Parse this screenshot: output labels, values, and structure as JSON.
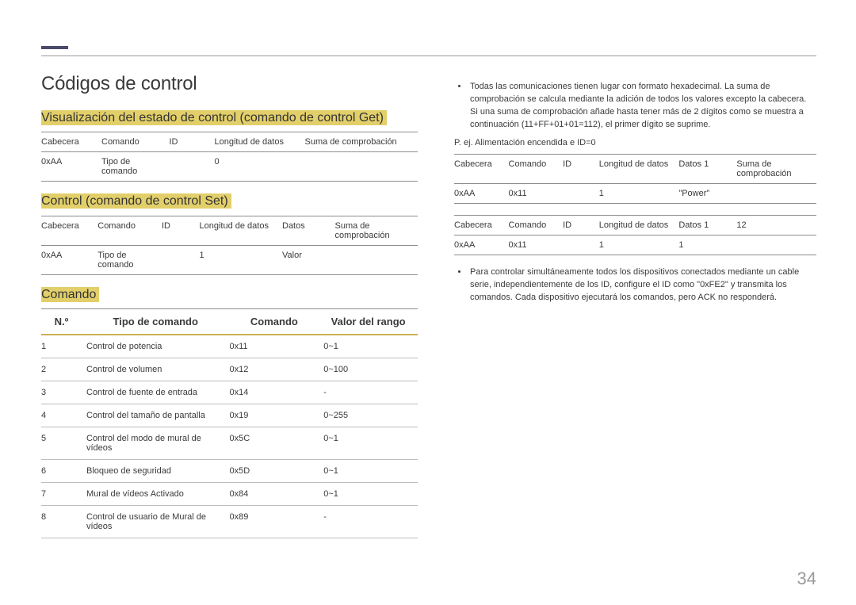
{
  "page_number": "34",
  "title": "Códigos de control",
  "section_get": {
    "heading": "Visualización del estado de control (comando de control Get)",
    "headers": [
      "Cabecera",
      "Comando",
      "ID",
      "Longitud de datos",
      "Suma de comprobación"
    ],
    "row": [
      "0xAA",
      "Tipo de comando",
      "",
      "0",
      ""
    ]
  },
  "section_set": {
    "heading": "Control (comando de control Set)",
    "headers": [
      "Cabecera",
      "Comando",
      "ID",
      "Longitud de datos",
      "Datos",
      "Suma de comprobación"
    ],
    "row": [
      "0xAA",
      "Tipo de comando",
      "",
      "1",
      "Valor",
      ""
    ]
  },
  "section_cmd": {
    "heading": "Comando",
    "headers": [
      "N.º",
      "Tipo de comando",
      "Comando",
      "Valor del rango"
    ],
    "rows": [
      [
        "1",
        "Control de potencia",
        "0x11",
        "0~1"
      ],
      [
        "2",
        "Control de volumen",
        "0x12",
        "0~100"
      ],
      [
        "3",
        "Control de fuente de entrada",
        "0x14",
        "-"
      ],
      [
        "4",
        "Control del tamaño de pantalla",
        "0x19",
        "0~255"
      ],
      [
        "5",
        "Control del modo de mural de vídeos",
        "0x5C",
        "0~1"
      ],
      [
        "6",
        "Bloqueo de seguridad",
        "0x5D",
        "0~1"
      ],
      [
        "7",
        "Mural de vídeos Activado",
        "0x84",
        "0~1"
      ],
      [
        "8",
        "Control de usuario de Mural de vídeos",
        "0x89",
        "-"
      ]
    ]
  },
  "right": {
    "bullet1": "Todas las comunicaciones tienen lugar con formato hexadecimal. La suma de comprobación se calcula mediante la adición de todos los valores excepto la cabecera. Si una suma de comprobación añade hasta tener más de 2 dígitos como se muestra a continuación (11+FF+01+01=112), el primer dígito se suprime.",
    "example_label": "P. ej. Alimentación encendida e ID=0",
    "ex_headers": [
      "Cabecera",
      "Comando",
      "ID",
      "Longitud de datos",
      "Datos 1",
      "Suma de comprobación"
    ],
    "ex_row1": [
      "0xAA",
      "0x11",
      "",
      "1",
      "\"Power\"",
      ""
    ],
    "ex_headers2": [
      "Cabecera",
      "Comando",
      "ID",
      "Longitud de datos",
      "Datos 1",
      "12"
    ],
    "ex_row2": [
      "0xAA",
      "0x11",
      "",
      "1",
      "1",
      ""
    ],
    "bullet2": "Para controlar simultáneamente todos los dispositivos conectados mediante un cable serie, independientemente de los ID, configure el ID como \"0xFE2\" y transmita los comandos. Cada dispositivo ejecutará los comandos, pero ACK no responderá."
  }
}
